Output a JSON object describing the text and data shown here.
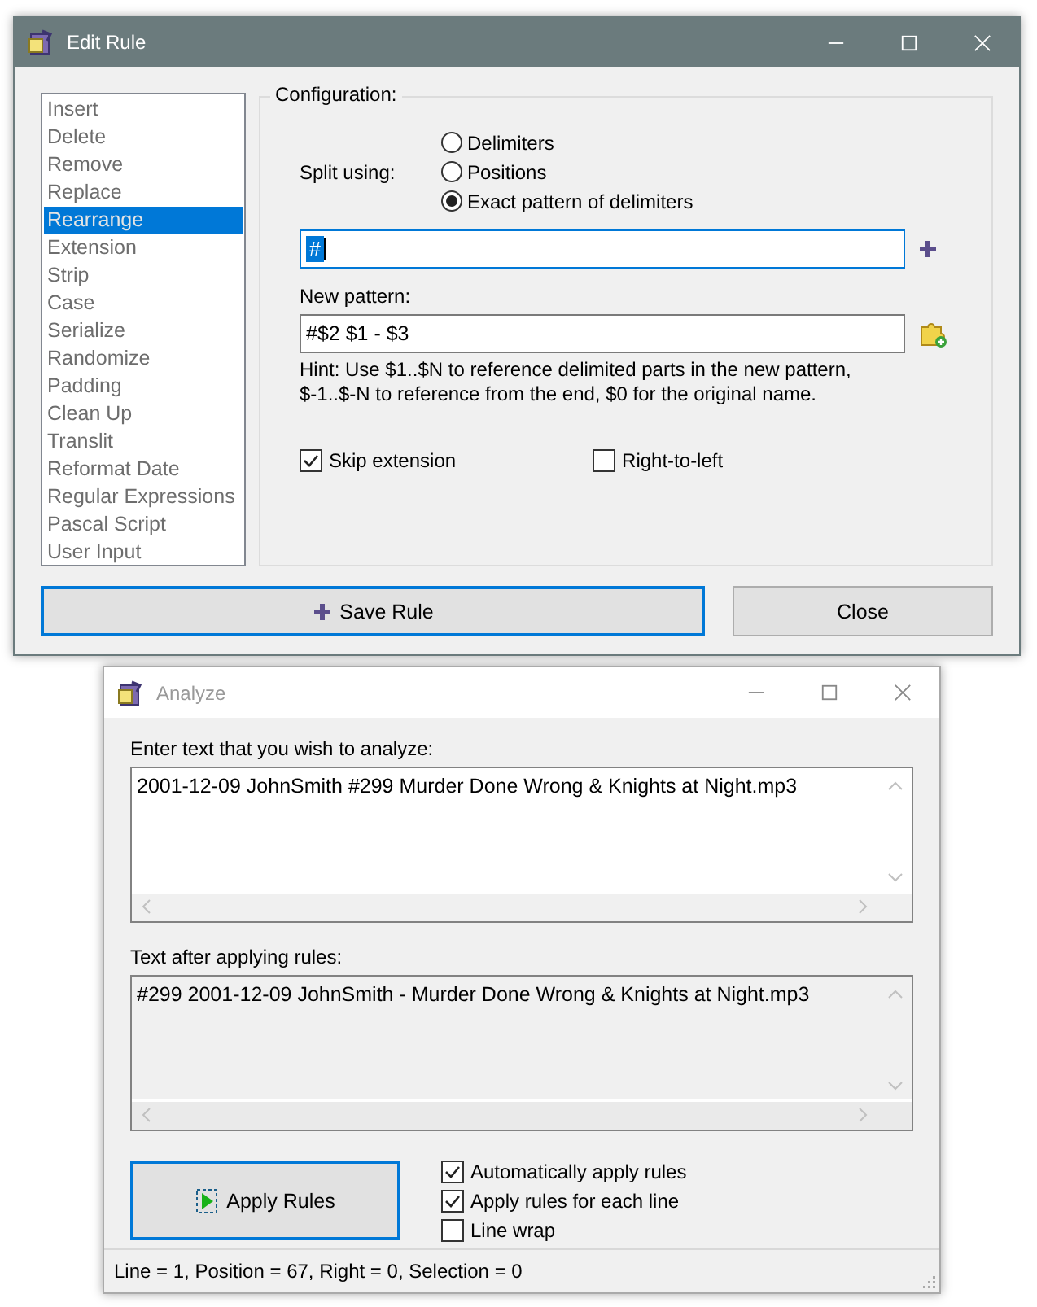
{
  "edit_window": {
    "title": "Edit Rule",
    "rules": [
      {
        "label": "Insert",
        "selected": false
      },
      {
        "label": "Delete",
        "selected": false
      },
      {
        "label": "Remove",
        "selected": false
      },
      {
        "label": "Replace",
        "selected": false
      },
      {
        "label": "Rearrange",
        "selected": true
      },
      {
        "label": "Extension",
        "selected": false
      },
      {
        "label": "Strip",
        "selected": false
      },
      {
        "label": "Case",
        "selected": false
      },
      {
        "label": "Serialize",
        "selected": false
      },
      {
        "label": "Randomize",
        "selected": false
      },
      {
        "label": "Padding",
        "selected": false
      },
      {
        "label": "Clean Up",
        "selected": false
      },
      {
        "label": "Translit",
        "selected": false
      },
      {
        "label": "Reformat Date",
        "selected": false
      },
      {
        "label": "Regular Expressions",
        "selected": false
      },
      {
        "label": "Pascal Script",
        "selected": false
      },
      {
        "label": "User Input",
        "selected": false
      }
    ],
    "group_title": "Configuration:",
    "split_label": "Split using:",
    "split_options": [
      {
        "label": "Delimiters",
        "selected": false
      },
      {
        "label": "Positions",
        "selected": false
      },
      {
        "label": "Exact pattern of delimiters",
        "selected": true
      }
    ],
    "delimiter_field": {
      "value": "#"
    },
    "new_pattern_label": "New pattern:",
    "new_pattern_field": {
      "value": "#$2 $1 - $3"
    },
    "hint": "Hint: Use $1..$N to reference delimited parts in the new pattern,\n$-1..$-N to reference from the end, $0 for the original name.",
    "options": [
      {
        "label": "Skip extension",
        "checked": true
      },
      {
        "label": "Right-to-left",
        "checked": false
      }
    ],
    "buttons": [
      {
        "label": "Save Rule",
        "kind": "primary"
      },
      {
        "label": "Close",
        "kind": "plain"
      }
    ]
  },
  "analyze_window": {
    "title": "Analyze",
    "input_label": "Enter text that you wish to analyze:",
    "input_text": "2001-12-09 JohnSmith #299 Murder Done Wrong & Knights at Night.mp3",
    "output_label": "Text after applying rules:",
    "output_text": "#299 2001-12-09 JohnSmith - Murder Done Wrong & Knights at Night.mp3",
    "apply_button": "Apply Rules",
    "options": [
      {
        "label": "Automatically apply rules",
        "checked": true
      },
      {
        "label": "Apply rules for each line",
        "checked": true
      },
      {
        "label": "Line wrap",
        "checked": false
      }
    ],
    "status_bar": "Line = 1, Position = 67, Right = 0, Selection = 0"
  }
}
